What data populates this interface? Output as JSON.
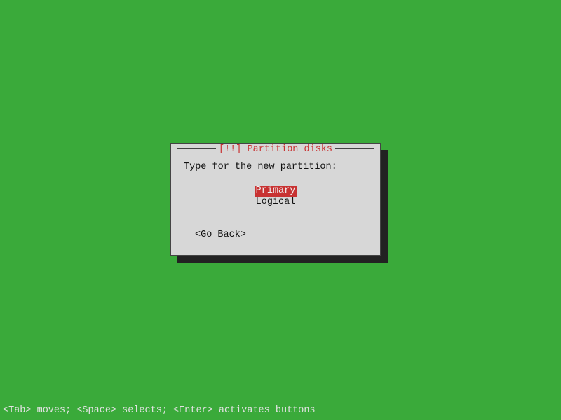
{
  "dialog": {
    "title": "[!!] Partition disks",
    "prompt": "Type for the new partition:",
    "options": {
      "primary": "Primary",
      "logical": "Logical"
    },
    "go_back": "<Go Back>"
  },
  "hint": "<Tab> moves; <Space> selects; <Enter> activates buttons",
  "colors": {
    "accent": "#c83232",
    "bg": "#3aaa3a",
    "dialog_bg": "#d7d7d7"
  }
}
